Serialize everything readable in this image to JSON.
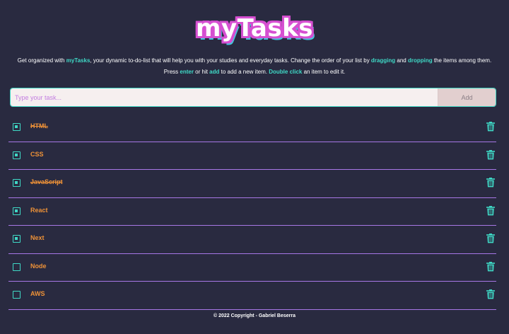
{
  "app": {
    "logo_text": "myTasks"
  },
  "intro": {
    "t1": "Get organized with ",
    "brand": "myTasks",
    "t2": ", your dynamic to-do-list that will help you with your studies and everyday tasks. Change the order of your list by ",
    "dragging": "dragging",
    "t3": " and ",
    "dropping": "dropping",
    "t4": " the items among them. Press ",
    "enter": "enter",
    "t5": " or hit ",
    "add": "add",
    "t6": " to add a new item. ",
    "dblclick": "Double click",
    "t7": " an item to edit it."
  },
  "form": {
    "placeholder": "Type your task...",
    "value": "",
    "add_label": "Add"
  },
  "tasks": [
    {
      "label": "HTML",
      "done": true
    },
    {
      "label": "CSS",
      "done": false
    },
    {
      "label": "JavaScript",
      "done": true
    },
    {
      "label": "React",
      "done": false
    },
    {
      "label": "Next",
      "done": false
    },
    {
      "label": "Node",
      "done": false
    },
    {
      "label": "AWS",
      "done": false
    }
  ],
  "checked": [
    true,
    true,
    true,
    true,
    true,
    false,
    false
  ],
  "colors": {
    "background": "#292a40",
    "accent": "#3fd9c6",
    "task_text": "#ef9237",
    "divider": "#a777e6",
    "logo_pink": "#d64fd1",
    "logo_cyan": "#45c6dd"
  },
  "icons": {
    "check": "checkbox-icon",
    "delete": "trash-icon"
  },
  "footer": {
    "text": "© 2022 Copyright - Gabriel Beserra"
  }
}
